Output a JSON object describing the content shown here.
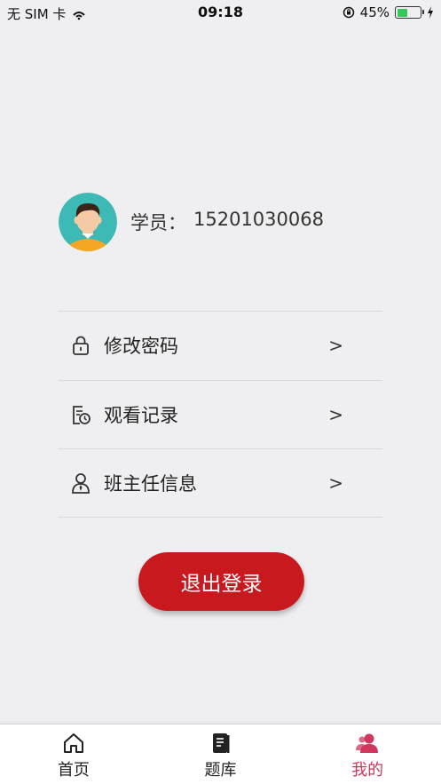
{
  "status_bar": {
    "carrier": "无 SIM 卡",
    "time": "09:18",
    "battery_percent": "45%",
    "battery_level": 0.45
  },
  "profile": {
    "role_label": "学员：",
    "phone": "15201030068"
  },
  "menu": {
    "items": [
      {
        "label": "修改密码",
        "arrow": ">",
        "icon": "lock-icon"
      },
      {
        "label": "观看记录",
        "arrow": ">",
        "icon": "history-icon"
      },
      {
        "label": "班主任信息",
        "arrow": ">",
        "icon": "teacher-icon"
      }
    ]
  },
  "logout_label": "退出登录",
  "tab_bar": {
    "tabs": [
      {
        "label": "首页",
        "icon": "home-icon",
        "active": false
      },
      {
        "label": "题库",
        "icon": "book-icon",
        "active": false
      },
      {
        "label": "我的",
        "icon": "user-icon",
        "active": true
      }
    ]
  },
  "colors": {
    "accent": "#c8191f",
    "active_tab": "#d1365c",
    "background": "#efeff1"
  }
}
